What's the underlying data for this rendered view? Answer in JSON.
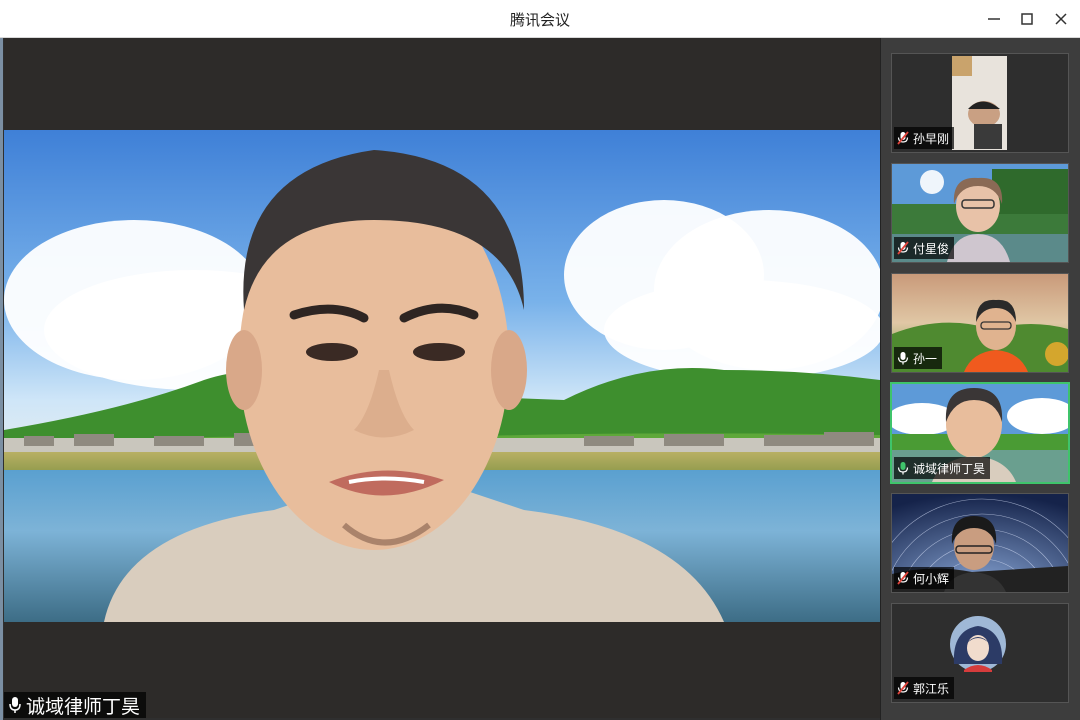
{
  "window": {
    "title": "腾讯会议",
    "minimize_icon": "minimize-icon",
    "maximize_icon": "maximize-icon",
    "close_icon": "close-icon"
  },
  "main_video": {
    "speaker_name": "诚域律师丁昊",
    "mic_status": "mic-on",
    "background": "virtual background: green grassland hills, lake, blue sky with clouds"
  },
  "participants": [
    {
      "name": "孙早刚",
      "mic": "muted",
      "active": false
    },
    {
      "name": "付星俊",
      "mic": "muted",
      "active": false
    },
    {
      "name": "孙一",
      "mic": "on",
      "active": false
    },
    {
      "name": "诚域律师丁昊",
      "mic": "speaking",
      "active": true
    },
    {
      "name": "何小辉",
      "mic": "muted",
      "active": false
    },
    {
      "name": "郭江乐",
      "mic": "muted",
      "active": false
    }
  ],
  "colors": {
    "active_border": "#3fc46b",
    "muted_mic": "#e0423a",
    "speaking_mic": "#3fc46b"
  }
}
